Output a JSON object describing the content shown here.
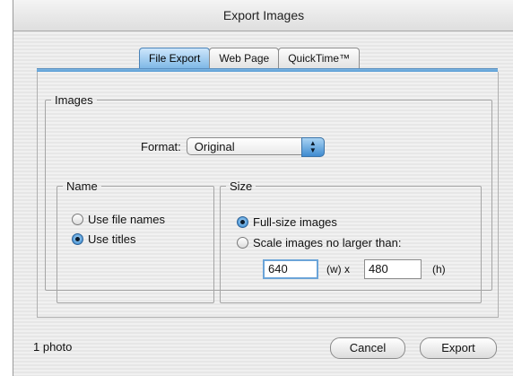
{
  "window": {
    "title": "Export Images"
  },
  "tabs": [
    {
      "label": "File Export",
      "active": true
    },
    {
      "label": "Web Page",
      "active": false
    },
    {
      "label": "QuickTime™",
      "active": false
    }
  ],
  "images": {
    "legend": "Images",
    "format_label": "Format:",
    "format_value": "Original"
  },
  "name": {
    "legend": "Name",
    "options": [
      {
        "label": "Use file names",
        "selected": false
      },
      {
        "label": "Use titles",
        "selected": true
      }
    ]
  },
  "size": {
    "legend": "Size",
    "options": [
      {
        "label": "Full-size images",
        "selected": true
      },
      {
        "label": "Scale images no larger than:",
        "selected": false
      }
    ],
    "width_value": "640",
    "width_unit": "(w) x",
    "height_value": "480",
    "height_unit": "(h)"
  },
  "footer": {
    "count": "1 photo",
    "cancel_label": "Cancel",
    "export_label": "Export"
  },
  "colors": {
    "accent": "#4d94d1"
  }
}
